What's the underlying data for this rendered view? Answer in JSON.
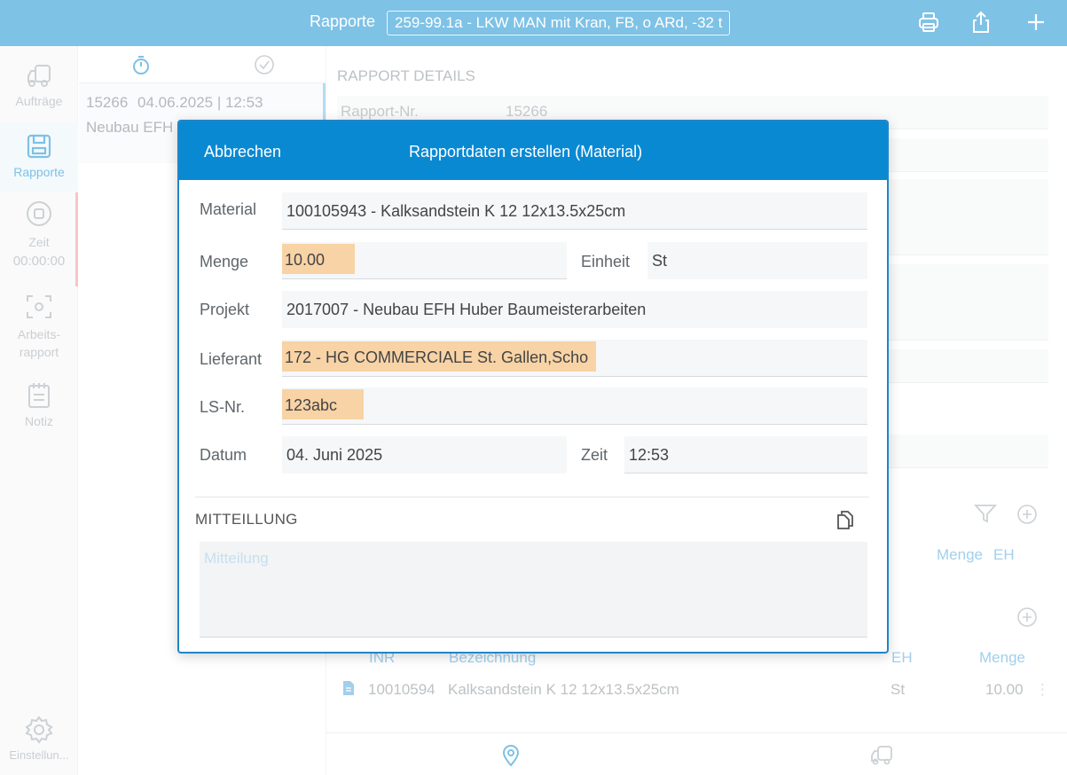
{
  "topbar": {
    "title": "Rapporte",
    "vehicle": "259-99.1a - LKW MAN mit Kran, FB, o ARd, -32 t",
    "icons": [
      "printer-icon",
      "share-icon",
      "plus-icon"
    ]
  },
  "sidebar": {
    "items": [
      {
        "label": "Aufträge",
        "icon": "truck-icon"
      },
      {
        "label": "Rapporte",
        "icon": "report-icon"
      },
      {
        "label": "Zeit",
        "sub": "00:00:00",
        "icon": "stop-icon"
      },
      {
        "label": "Arbeits-",
        "label2": "rapport",
        "icon": "scan-icon"
      },
      {
        "label": "Notiz",
        "icon": "notepad-icon"
      },
      {
        "label": "Einstellun...",
        "icon": "gear-icon"
      }
    ]
  },
  "list": {
    "items": [
      {
        "number": "15266",
        "datetime": "04.06.2025 | 12:53",
        "subtitle": "Neubau EFH"
      }
    ]
  },
  "details": {
    "title": "RAPPORT DETAILS",
    "rapport_nr_label": "Rapport-Nr.",
    "rapport_nr_value": "15266",
    "materials_columns": {
      "menge": "Menge",
      "eh": "EH"
    },
    "positions_columns": {
      "inr": "INR",
      "bezeichnung": "Bezeichnung",
      "eh": "EH",
      "menge": "Menge"
    },
    "positions": [
      {
        "inr": "10010594",
        "bezeichnung": "Kalksandstein K 12 12x13.5x25cm",
        "eh": "St",
        "menge": "10.00"
      }
    ]
  },
  "modal": {
    "cancel": "Abbrechen",
    "title": "Rapportdaten erstellen (Material)",
    "fields": {
      "material": {
        "label": "Material",
        "value": "100105943 - Kalksandstein K 12 12x13.5x25cm"
      },
      "menge": {
        "label": "Menge",
        "value": "10.00"
      },
      "einheit": {
        "label": "Einheit",
        "value": "St"
      },
      "projekt": {
        "label": "Projekt",
        "value": "2017007 - Neubau EFH Huber Baumeisterarbeiten"
      },
      "lieferant": {
        "label": "Lieferant",
        "value": "172 - HG COMMERCIALE St. Gallen,Scho"
      },
      "ls_nr": {
        "label": "LS-Nr.",
        "value": "123abc"
      },
      "datum": {
        "label": "Datum",
        "value": "04. Juni 2025"
      },
      "zeit": {
        "label": "Zeit",
        "value": "12:53"
      }
    },
    "message": {
      "title": "MITTEILLUNG",
      "placeholder": "Mitteilung"
    }
  },
  "colors": {
    "topbar": "#7ec2e6",
    "modal_header": "#0a89d3",
    "highlight": "#f8d3a6",
    "accent": "#3aa0d8"
  }
}
